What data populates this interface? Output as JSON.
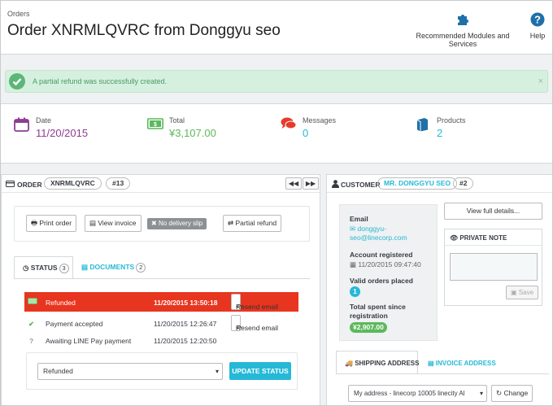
{
  "header": {
    "breadcrumb": "Orders",
    "title": "Order XNRMLQVRC from Donggyu seo",
    "toolbar": [
      {
        "label": "Recommended Modules and Services",
        "icon": "puzzle-icon"
      },
      {
        "label": "Help",
        "icon": "help-icon"
      }
    ]
  },
  "alert": {
    "text": "A partial refund was successfully created.",
    "close": "×",
    "color": "#5cb677"
  },
  "kpis": [
    {
      "label": "Date",
      "value": "11/20/2015",
      "icon": "calendar-icon",
      "color": "#8c3e8f"
    },
    {
      "label": "Total",
      "value": "¥3,107.00",
      "icon": "money-icon",
      "color": "#5cb85c"
    },
    {
      "label": "Messages",
      "value": "0",
      "icon": "comments-icon",
      "color": "#25b9d7"
    },
    {
      "label": "Products",
      "value": "2",
      "icon": "book-icon",
      "color": "#25b9d7"
    }
  ],
  "order": {
    "label": "ORDER",
    "reference": "XNRMLQVRC",
    "number": "#13",
    "prev": "◀◀",
    "next": "▶▶",
    "actions": {
      "print": "Print order",
      "view_invoice": "View invoice",
      "no_delivery": "No delivery slip",
      "partial_refund": "Partial refund"
    },
    "tabs": {
      "status": "STATUS",
      "status_count": "3",
      "documents": "DOCUMENTS",
      "documents_count": "2"
    },
    "history": [
      {
        "status": "Refunded",
        "date": "11/20/2015 13:50:18",
        "resend": "Resend email"
      },
      {
        "status": "Payment accepted",
        "date": "11/20/2015 12:26:47",
        "resend": "Resend email"
      },
      {
        "status": "Awaiting LINE Pay payment",
        "date": "11/20/2015 12:20:50"
      }
    ],
    "status_select": "Refunded",
    "update_status": "UPDATE STATUS"
  },
  "customer": {
    "label": "CUSTOMER",
    "name": "MR. DONGGYU SEO",
    "number": "#2",
    "email_label": "Email",
    "email_line1": "donggyu-",
    "email_line2": "seo@linecorp.com",
    "account_label": "Account registered",
    "account_value": "11/20/2015 09:47:40",
    "valid_orders_label": "Valid orders placed",
    "valid_orders_value": "1",
    "total_spent_line1": "Total spent since",
    "total_spent_line2": "registration",
    "total_spent_value": "¥2,907.00",
    "view_details": "View full details...",
    "private_note_label": "PRIVATE NOTE",
    "save": "Save",
    "tabs": {
      "shipping": "SHIPPING ADDRESS",
      "invoice": "INVOICE ADDRESS"
    },
    "address_select": "My address - linecorp 10005 linecity Al",
    "change": "Change"
  }
}
